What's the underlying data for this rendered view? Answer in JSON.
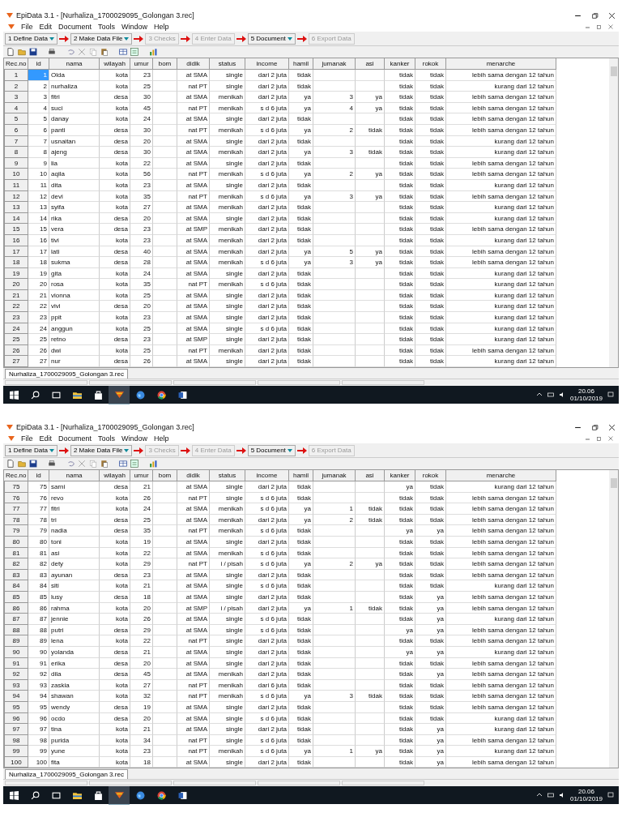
{
  "screenshots": [
    {
      "window": {
        "title": "EpiData 3.1 - [Nurhaliza_1700029095_Golongan 3.rec]"
      },
      "menu": [
        "File",
        "Edit",
        "Document",
        "Tools",
        "Window",
        "Help"
      ],
      "workflow": [
        {
          "label": "1 Define Data",
          "disabled": false,
          "dropdown": true
        },
        {
          "label": "2 Make Data File",
          "disabled": false,
          "dropdown": true
        },
        {
          "label": "3 Checks",
          "disabled": true,
          "dropdown": false
        },
        {
          "label": "4 Enter Data",
          "disabled": true,
          "dropdown": false
        },
        {
          "label": "5 Document",
          "disabled": false,
          "dropdown": true
        },
        {
          "label": "6 Export Data",
          "disabled": true,
          "dropdown": false
        }
      ],
      "columns": [
        "Rec.no",
        "id",
        "nama",
        "wilayah",
        "umur",
        "bom",
        "didik",
        "status",
        "income",
        "hamil",
        "jumanak",
        "asi",
        "kanker",
        "rokok",
        "menarche"
      ],
      "rows": [
        {
          "selected": true,
          "cells": [
            "1",
            "1",
            "Olda",
            "kota",
            "23",
            null,
            "at SMA",
            "single",
            "dari 2 juta",
            "tidak",
            null,
            null,
            "tidak",
            "tidak",
            "lebih sama dengan 12 tahun"
          ]
        },
        {
          "selected": false,
          "cells": [
            "2",
            "2",
            "nurhaliza",
            "kota",
            "25",
            null,
            "nat PT",
            "single",
            "dari 2 juta",
            "tidak",
            null,
            null,
            "tidak",
            "tidak",
            "kurang dari 12 tahun"
          ]
        },
        {
          "selected": false,
          "cells": [
            "3",
            "3",
            "fitri",
            "desa",
            "30",
            null,
            "at SMA",
            "menikah",
            "dari 2 juta",
            "ya",
            "3",
            "ya",
            "tidak",
            "tidak",
            "lebih sama dengan 12 tahun"
          ]
        },
        {
          "selected": false,
          "cells": [
            "4",
            "4",
            "suci",
            "kota",
            "45",
            null,
            "nat PT",
            "menikah",
            "s d 6 juta",
            "ya",
            "4",
            "ya",
            "tidak",
            "tidak",
            "lebih sama dengan 12 tahun"
          ]
        },
        {
          "selected": false,
          "cells": [
            "5",
            "5",
            "danay",
            "kota",
            "24",
            null,
            "at SMA",
            "single",
            "dari 2 juta",
            "tidak",
            null,
            null,
            "tidak",
            "tidak",
            "lebih sama dengan 12 tahun"
          ]
        },
        {
          "selected": false,
          "cells": [
            "6",
            "6",
            "panti",
            "desa",
            "30",
            null,
            "nat PT",
            "menikah",
            "s d 6 juta",
            "ya",
            "2",
            "tidak",
            "tidak",
            "tidak",
            "lebih sama dengan 12 tahun"
          ]
        },
        {
          "selected": false,
          "cells": [
            "7",
            "7",
            "usnaitan",
            "desa",
            "20",
            null,
            "at SMA",
            "single",
            "dari 2 juta",
            "tidak",
            null,
            null,
            "tidak",
            "tidak",
            "kurang dari 12 tahun"
          ]
        },
        {
          "selected": false,
          "cells": [
            "8",
            "8",
            "ajeng",
            "desa",
            "30",
            null,
            "at SMA",
            "menikah",
            "dari 2 juta",
            "ya",
            "3",
            "tidak",
            "tidak",
            "tidak",
            "kurang dari 12 tahun"
          ]
        },
        {
          "selected": false,
          "cells": [
            "9",
            "9",
            "lia",
            "kota",
            "22",
            null,
            "at SMA",
            "single",
            "dari 2 juta",
            "tidak",
            null,
            null,
            "tidak",
            "tidak",
            "lebih sama dengan 12 tahun"
          ]
        },
        {
          "selected": false,
          "cells": [
            "10",
            "10",
            "aqila",
            "kota",
            "56",
            null,
            "nat PT",
            "menikah",
            "s d 6 juta",
            "ya",
            "2",
            "ya",
            "tidak",
            "tidak",
            "lebih sama dengan 12 tahun"
          ]
        },
        {
          "selected": false,
          "cells": [
            "11",
            "11",
            "dita",
            "kota",
            "23",
            null,
            "at SMA",
            "single",
            "dari 2 juta",
            "tidak",
            null,
            null,
            "tidak",
            "tidak",
            "kurang dari 12 tahun"
          ]
        },
        {
          "selected": false,
          "cells": [
            "12",
            "12",
            "devi",
            "kota",
            "35",
            null,
            "nat PT",
            "menikah",
            "s d 6 juta",
            "ya",
            "3",
            "ya",
            "tidak",
            "tidak",
            "lebih sama dengan 12 tahun"
          ]
        },
        {
          "selected": false,
          "cells": [
            "13",
            "13",
            "syifa",
            "kota",
            "27",
            null,
            "at SMA",
            "menikah",
            "dari 2 juta",
            "tidak",
            null,
            null,
            "tidak",
            "tidak",
            "kurang dari 12 tahun"
          ]
        },
        {
          "selected": false,
          "cells": [
            "14",
            "14",
            "rika",
            "desa",
            "20",
            null,
            "at SMA",
            "single",
            "dari 2 juta",
            "tidak",
            null,
            null,
            "tidak",
            "tidak",
            "kurang dari 12 tahun"
          ]
        },
        {
          "selected": false,
          "cells": [
            "15",
            "15",
            "vera",
            "desa",
            "23",
            null,
            "at SMP",
            "menikah",
            "dari 2 juta",
            "tidak",
            null,
            null,
            "tidak",
            "tidak",
            "lebih sama dengan 12 tahun"
          ]
        },
        {
          "selected": false,
          "cells": [
            "16",
            "16",
            "tivi",
            "kota",
            "23",
            null,
            "at SMA",
            "menikah",
            "dari 2 juta",
            "tidak",
            null,
            null,
            "tidak",
            "tidak",
            "kurang dari 12 tahun"
          ]
        },
        {
          "selected": false,
          "cells": [
            "17",
            "17",
            "lati",
            "desa",
            "40",
            null,
            "at SMA",
            "menikah",
            "dari 2 juta",
            "ya",
            "5",
            "ya",
            "tidak",
            "tidak",
            "lebih sama dengan 12 tahun"
          ]
        },
        {
          "selected": false,
          "cells": [
            "18",
            "18",
            "sukma",
            "desa",
            "28",
            null,
            "at SMA",
            "menikah",
            "s d 6 juta",
            "ya",
            "3",
            "ya",
            "tidak",
            "tidak",
            "lebih sama dengan 12 tahun"
          ]
        },
        {
          "selected": false,
          "cells": [
            "19",
            "19",
            "gita",
            "kota",
            "24",
            null,
            "at SMA",
            "single",
            "dari 2 juta",
            "tidak",
            null,
            null,
            "tidak",
            "tidak",
            "kurang dari 12 tahun"
          ]
        },
        {
          "selected": false,
          "cells": [
            "20",
            "20",
            "rosa",
            "kota",
            "35",
            null,
            "nat PT",
            "menikah",
            "s d 6 juta",
            "tidak",
            null,
            null,
            "tidak",
            "tidak",
            "kurang dari 12 tahun"
          ]
        },
        {
          "selected": false,
          "cells": [
            "21",
            "21",
            "vionna",
            "kota",
            "25",
            null,
            "at SMA",
            "single",
            "dari 2 juta",
            "tidak",
            null,
            null,
            "tidak",
            "tidak",
            "kurang dari 12 tahun"
          ]
        },
        {
          "selected": false,
          "cells": [
            "22",
            "22",
            "vivi",
            "desa",
            "20",
            null,
            "at SMA",
            "single",
            "dari 2 juta",
            "tidak",
            null,
            null,
            "tidak",
            "tidak",
            "kurang dari 12 tahun"
          ]
        },
        {
          "selected": false,
          "cells": [
            "23",
            "23",
            "ppit",
            "kota",
            "23",
            null,
            "at SMA",
            "single",
            "dari 2 juta",
            "tidak",
            null,
            null,
            "tidak",
            "tidak",
            "kurang dari 12 tahun"
          ]
        },
        {
          "selected": false,
          "cells": [
            "24",
            "24",
            "anggun",
            "kota",
            "25",
            null,
            "at SMA",
            "single",
            "s d 6 juta",
            "tidak",
            null,
            null,
            "tidak",
            "tidak",
            "kurang dari 12 tahun"
          ]
        },
        {
          "selected": false,
          "cells": [
            "25",
            "25",
            "retno",
            "desa",
            "23",
            null,
            "at SMP",
            "single",
            "dari 2 juta",
            "tidak",
            null,
            null,
            "tidak",
            "tidak",
            "kurang dari 12 tahun"
          ]
        },
        {
          "selected": false,
          "cells": [
            "26",
            "26",
            "dwi",
            "kota",
            "25",
            null,
            "nat PT",
            "menikah",
            "dari 2 juta",
            "tidak",
            null,
            null,
            "tidak",
            "tidak",
            "lebih sama dengan 12 tahun"
          ]
        },
        {
          "selected": false,
          "cells": [
            "27",
            "27",
            "nur",
            "desa",
            "26",
            null,
            "at SMA",
            "single",
            "dari 2 juta",
            "tidak",
            null,
            null,
            "tidak",
            "tidak",
            "kurang dari 12 tahun"
          ]
        }
      ],
      "file_tab": "Nurhaliza_1700029095_Golongan 3.rec",
      "taskbar": {
        "time": "20.06",
        "date": "01/10/2019"
      }
    },
    {
      "window": {
        "title": "EpiData 3.1 - [Nurhaliza_1700029095_Golongan 3.rec]"
      },
      "menu": [
        "File",
        "Edit",
        "Document",
        "Tools",
        "Window",
        "Help"
      ],
      "workflow": [
        {
          "label": "1 Define Data",
          "disabled": false,
          "dropdown": true
        },
        {
          "label": "2 Make Data File",
          "disabled": false,
          "dropdown": true
        },
        {
          "label": "3 Checks",
          "disabled": true,
          "dropdown": false
        },
        {
          "label": "4 Enter Data",
          "disabled": true,
          "dropdown": false
        },
        {
          "label": "5 Document",
          "disabled": false,
          "dropdown": true
        },
        {
          "label": "6 Export Data",
          "disabled": true,
          "dropdown": false
        }
      ],
      "columns": [
        "Rec.no",
        "id",
        "nama",
        "wilayah",
        "umur",
        "bom",
        "didik",
        "status",
        "income",
        "hamil",
        "jumanak",
        "asi",
        "kanker",
        "rokok",
        "menarche"
      ],
      "rows": [
        {
          "selected": false,
          "cells": [
            "75",
            "75",
            "sarni",
            "desa",
            "21",
            null,
            "at SMA",
            "single",
            "dari 2 juta",
            "tidak",
            null,
            null,
            "ya",
            "tidak",
            "kurang dari 12 tahun"
          ]
        },
        {
          "selected": false,
          "cells": [
            "76",
            "76",
            "revo",
            "kota",
            "26",
            null,
            "nat PT",
            "single",
            "s d 6 juta",
            "tidak",
            null,
            null,
            "tidak",
            "tidak",
            "lebih sama dengan 12 tahun"
          ]
        },
        {
          "selected": false,
          "cells": [
            "77",
            "77",
            "fitri",
            "kota",
            "24",
            null,
            "at SMA",
            "menikah",
            "s d 6 juta",
            "ya",
            "1",
            "tidak",
            "tidak",
            "tidak",
            "lebih sama dengan 12 tahun"
          ]
        },
        {
          "selected": false,
          "cells": [
            "78",
            "78",
            "tri",
            "desa",
            "25",
            null,
            "at SMA",
            "menikah",
            "dari 2 juta",
            "ya",
            "2",
            "tidak",
            "tidak",
            "tidak",
            "lebih sama dengan 12 tahun"
          ]
        },
        {
          "selected": false,
          "cells": [
            "79",
            "79",
            "nadia",
            "desa",
            "35",
            null,
            "nat PT",
            "menikah",
            "s d 6 juta",
            "tidak",
            null,
            null,
            "ya",
            "ya",
            "lebih sama dengan 12 tahun"
          ]
        },
        {
          "selected": false,
          "cells": [
            "80",
            "80",
            "toni",
            "kota",
            "19",
            null,
            "at SMA",
            "single",
            "dari 2 juta",
            "tidak",
            null,
            null,
            "tidak",
            "tidak",
            "lebih sama dengan 12 tahun"
          ]
        },
        {
          "selected": false,
          "cells": [
            "81",
            "81",
            "asi",
            "kota",
            "22",
            null,
            "at SMA",
            "menikah",
            "s d 6 juta",
            "tidak",
            null,
            null,
            "tidak",
            "tidak",
            "lebih sama dengan 12 tahun"
          ]
        },
        {
          "selected": false,
          "cells": [
            "82",
            "82",
            "dety",
            "kota",
            "29",
            null,
            "nat PT",
            "i / pisah",
            "s d 6 juta",
            "ya",
            "2",
            "ya",
            "tidak",
            "tidak",
            "lebih sama dengan 12 tahun"
          ]
        },
        {
          "selected": false,
          "cells": [
            "83",
            "83",
            "ayunan",
            "desa",
            "23",
            null,
            "at SMA",
            "single",
            "dari 2 juta",
            "tidak",
            null,
            null,
            "tidak",
            "tidak",
            "lebih sama dengan 12 tahun"
          ]
        },
        {
          "selected": false,
          "cells": [
            "84",
            "84",
            "siti",
            "kota",
            "21",
            null,
            "at SMA",
            "single",
            "s d 6 juta",
            "tidak",
            null,
            null,
            "tidak",
            "tidak",
            "kurang dari 12 tahun"
          ]
        },
        {
          "selected": false,
          "cells": [
            "85",
            "85",
            "lusy",
            "desa",
            "18",
            null,
            "at SMA",
            "single",
            "dari 2 juta",
            "tidak",
            null,
            null,
            "tidak",
            "ya",
            "lebih sama dengan 12 tahun"
          ]
        },
        {
          "selected": false,
          "cells": [
            "86",
            "86",
            "rahma",
            "kota",
            "20",
            null,
            "at SMP",
            "i / pisah",
            "dari 2 juta",
            "ya",
            "1",
            "tidak",
            "tidak",
            "ya",
            "lebih sama dengan 12 tahun"
          ]
        },
        {
          "selected": false,
          "cells": [
            "87",
            "87",
            "jennie",
            "kota",
            "26",
            null,
            "at SMA",
            "single",
            "s d 6 juta",
            "tidak",
            null,
            null,
            "tidak",
            "ya",
            "kurang dari 12 tahun"
          ]
        },
        {
          "selected": false,
          "cells": [
            "88",
            "88",
            "putri",
            "desa",
            "29",
            null,
            "at SMA",
            "single",
            "s d 6 juta",
            "tidak",
            null,
            null,
            "ya",
            "ya",
            "lebih sama dengan 12 tahun"
          ]
        },
        {
          "selected": false,
          "cells": [
            "89",
            "89",
            "lena",
            "kota",
            "22",
            null,
            "nat PT",
            "single",
            "dari 2 juta",
            "tidak",
            null,
            null,
            "tidak",
            "tidak",
            "lebih sama dengan 12 tahun"
          ]
        },
        {
          "selected": false,
          "cells": [
            "90",
            "90",
            "yolanda",
            "desa",
            "21",
            null,
            "at SMA",
            "single",
            "dari 2 juta",
            "tidak",
            null,
            null,
            "ya",
            "ya",
            "kurang dari 12 tahun"
          ]
        },
        {
          "selected": false,
          "cells": [
            "91",
            "91",
            "erika",
            "desa",
            "20",
            null,
            "at SMA",
            "single",
            "dari 2 juta",
            "tidak",
            null,
            null,
            "tidak",
            "tidak",
            "lebih sama dengan 12 tahun"
          ]
        },
        {
          "selected": false,
          "cells": [
            "92",
            "92",
            "dila",
            "desa",
            "45",
            null,
            "at SMA",
            "menikah",
            "dari 2 juta",
            "tidak",
            null,
            null,
            "tidak",
            "ya",
            "lebih sama dengan 12 tahun"
          ]
        },
        {
          "selected": false,
          "cells": [
            "93",
            "93",
            "zaskia",
            "kota",
            "27",
            null,
            "nat PT",
            "menikah",
            "dari 6 juta",
            "tidak",
            null,
            null,
            "tidak",
            "tidak",
            "lebih sama dengan 12 tahun"
          ]
        },
        {
          "selected": false,
          "cells": [
            "94",
            "94",
            "shawan",
            "kota",
            "32",
            null,
            "nat PT",
            "menikah",
            "s d 6 juta",
            "ya",
            "3",
            "tidak",
            "tidak",
            "tidak",
            "lebih sama dengan 12 tahun"
          ]
        },
        {
          "selected": false,
          "cells": [
            "95",
            "95",
            "wendy",
            "desa",
            "19",
            null,
            "at SMA",
            "single",
            "dari 2 juta",
            "tidak",
            null,
            null,
            "tidak",
            "tidak",
            "lebih sama dengan 12 tahun"
          ]
        },
        {
          "selected": false,
          "cells": [
            "96",
            "96",
            "ocdo",
            "desa",
            "20",
            null,
            "at SMA",
            "single",
            "s d 6 juta",
            "tidak",
            null,
            null,
            "tidak",
            "tidak",
            "kurang dari 12 tahun"
          ]
        },
        {
          "selected": false,
          "cells": [
            "97",
            "97",
            "tina",
            "kota",
            "21",
            null,
            "at SMA",
            "single",
            "dari 2 juta",
            "tidak",
            null,
            null,
            "tidak",
            "ya",
            "kurang dari 12 tahun"
          ]
        },
        {
          "selected": false,
          "cells": [
            "98",
            "98",
            "purida",
            "kota",
            "34",
            null,
            "nat PT",
            "single",
            "s d 6 juta",
            "tidak",
            null,
            null,
            "tidak",
            "ya",
            "lebih sama dengan 12 tahun"
          ]
        },
        {
          "selected": false,
          "cells": [
            "99",
            "99",
            "yune",
            "kota",
            "23",
            null,
            "nat PT",
            "menikah",
            "s d 6 juta",
            "ya",
            "1",
            "ya",
            "tidak",
            "ya",
            "kurang dari 12 tahun"
          ]
        },
        {
          "selected": false,
          "cells": [
            "100",
            "100",
            "fita",
            "kota",
            "18",
            null,
            "at SMA",
            "single",
            "dari 2 juta",
            "tidak",
            null,
            null,
            "tidak",
            "ya",
            "lebih sama dengan 12 tahun"
          ]
        }
      ],
      "file_tab": "Nurhaliza_1700029095_Golongan 3.rec",
      "taskbar": {
        "time": "20.06",
        "date": "01/10/2019"
      }
    }
  ]
}
